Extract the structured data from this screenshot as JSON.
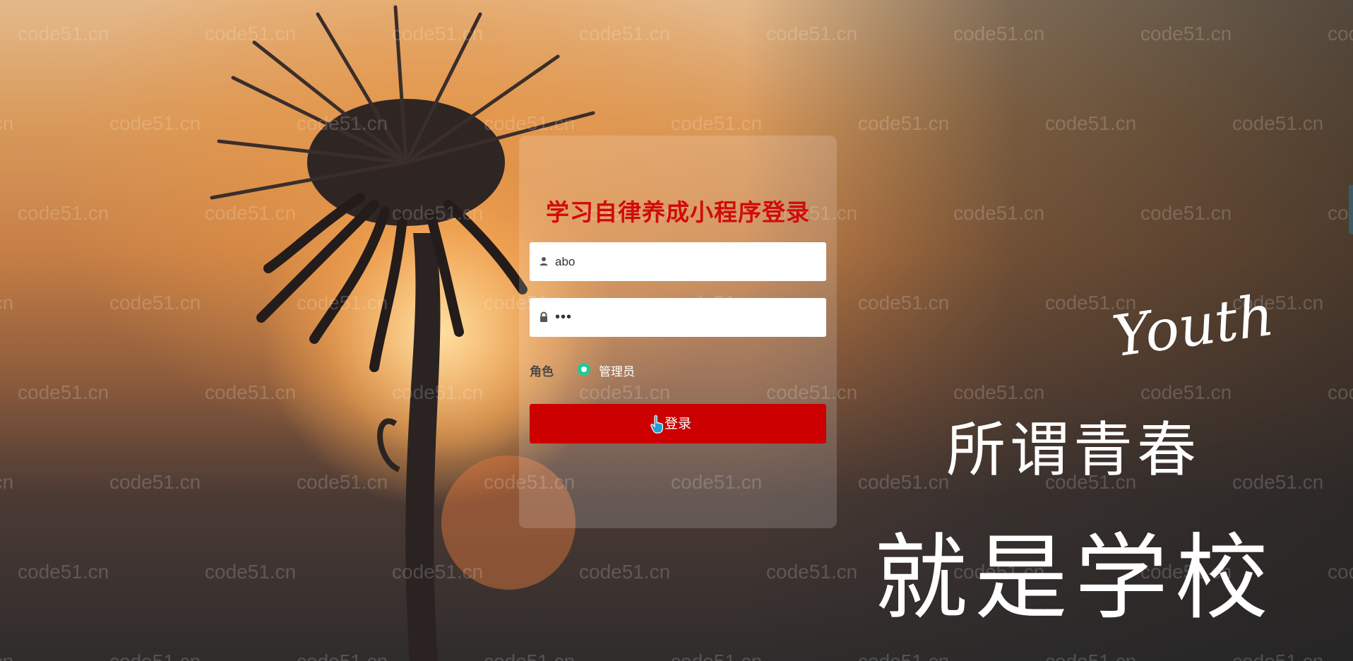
{
  "login": {
    "title": "学习自律养成小程序登录",
    "username_value": "abo",
    "password_value": "•••",
    "role_label": "角色",
    "role_option": "管理员",
    "submit_label": "登录"
  },
  "slogan": {
    "english": "Youth",
    "line1": "所谓青春",
    "line2": "就是学校"
  },
  "watermark": {
    "text": "code51.cn"
  },
  "colors": {
    "title": "#d10b0b",
    "button": "#cc0000",
    "radio": "#20c997"
  },
  "icons": {
    "username": "user-icon",
    "password": "lock-icon",
    "cursor": "hand-pointer-icon"
  }
}
